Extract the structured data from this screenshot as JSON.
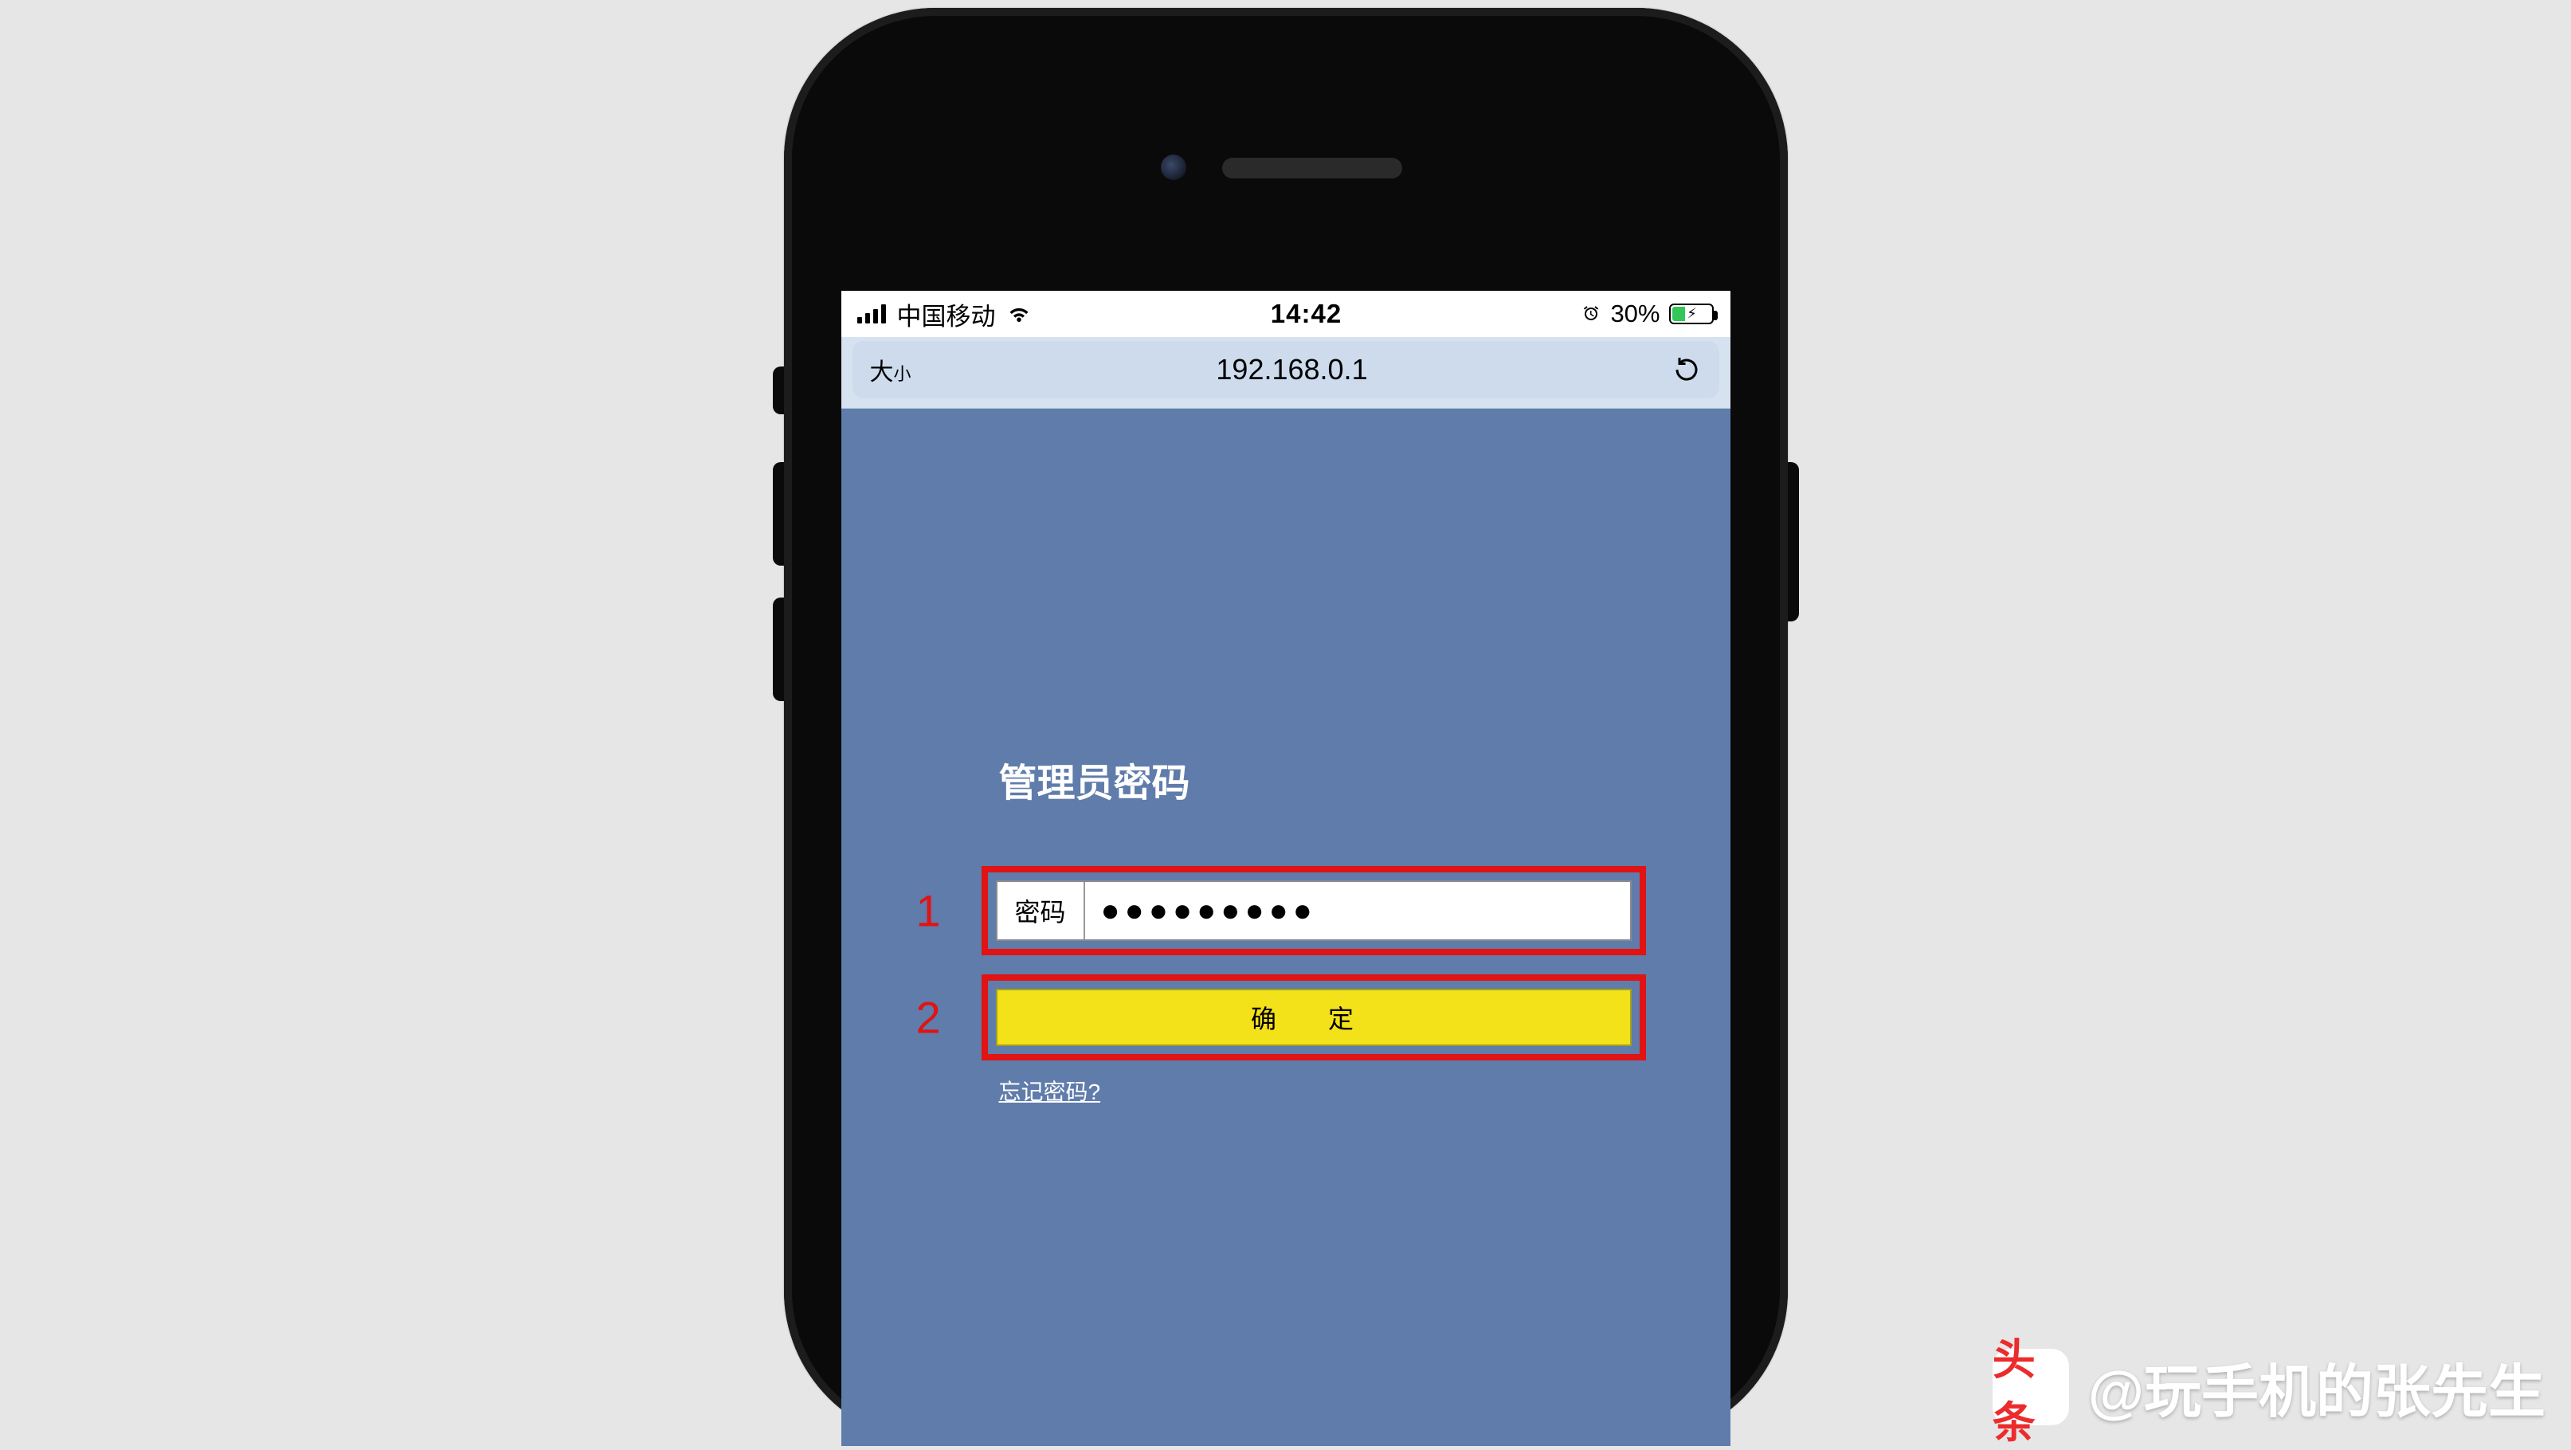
{
  "status": {
    "carrier": "中国移动",
    "time": "14:42",
    "batteryPercent": "30%"
  },
  "browser": {
    "textSizeLarge": "大",
    "textSizeSmall": "小",
    "url": "192.168.0.1"
  },
  "login": {
    "title": "管理员密码",
    "annotation1": "1",
    "annotation2": "2",
    "passwordLabel": "密码",
    "passwordValue": "●●●●●●●●●",
    "confirmLabel": "确 定",
    "forgotLabel": "忘记密码?"
  },
  "watermark": {
    "logo": "头条",
    "text": "@玩手机的张先生"
  }
}
